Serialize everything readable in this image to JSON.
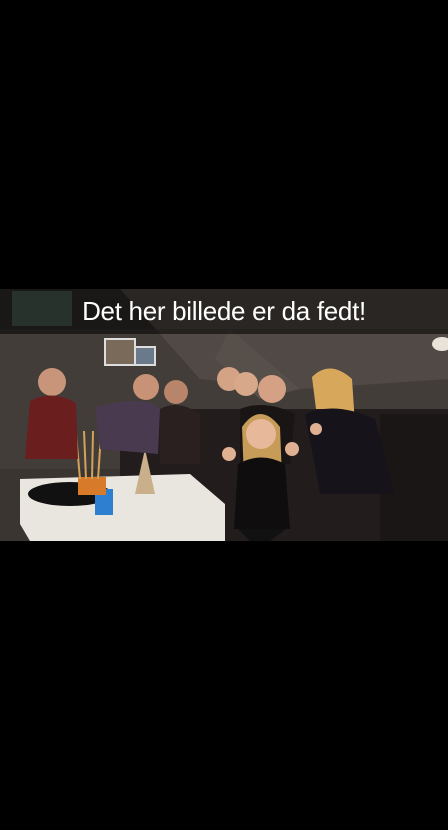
{
  "snap": {
    "caption": "Det her billede er da fedt!",
    "photo_label": "",
    "colors": {
      "background": "#000000",
      "caption_bar": "rgba(0,0,0,0.55)",
      "caption_text": "#ffffff"
    }
  }
}
